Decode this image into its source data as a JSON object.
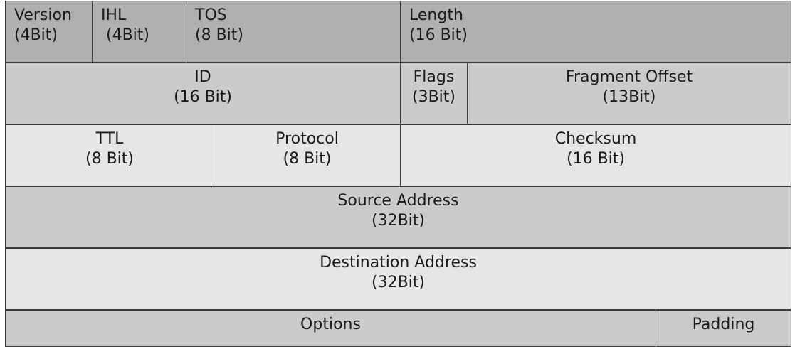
{
  "colors": {
    "dark": "#b0b0b0",
    "mid": "#cbcbcb",
    "light": "#e6e6e6",
    "border": "#3a3a3a"
  },
  "rows": [
    {
      "cells": [
        {
          "name": "Version",
          "size": "(4Bit)"
        },
        {
          "name": "IHL",
          "size": " (4Bit)"
        },
        {
          "name": "TOS",
          "size": "(8 Bit)"
        },
        {
          "name": "Length",
          "size": "(16 Bit)"
        }
      ]
    },
    {
      "cells": [
        {
          "name": "ID",
          "size": "(16 Bit)"
        },
        {
          "name": "Flags",
          "size": "(3Bit)"
        },
        {
          "name": "Fragment Offset",
          "size": "(13Bit)"
        }
      ]
    },
    {
      "cells": [
        {
          "name": "TTL",
          "size": "(8 Bit)"
        },
        {
          "name": "Protocol",
          "size": "(8 Bit)"
        },
        {
          "name": "Checksum",
          "size": "(16 Bit)"
        }
      ]
    },
    {
      "cells": [
        {
          "name": "Source Address",
          "size": "(32Bit)"
        }
      ]
    },
    {
      "cells": [
        {
          "name": "Destination Address",
          "size": "(32Bit)"
        }
      ]
    },
    {
      "cells": [
        {
          "name": "Options"
        },
        {
          "name": "Padding"
        }
      ]
    }
  ]
}
